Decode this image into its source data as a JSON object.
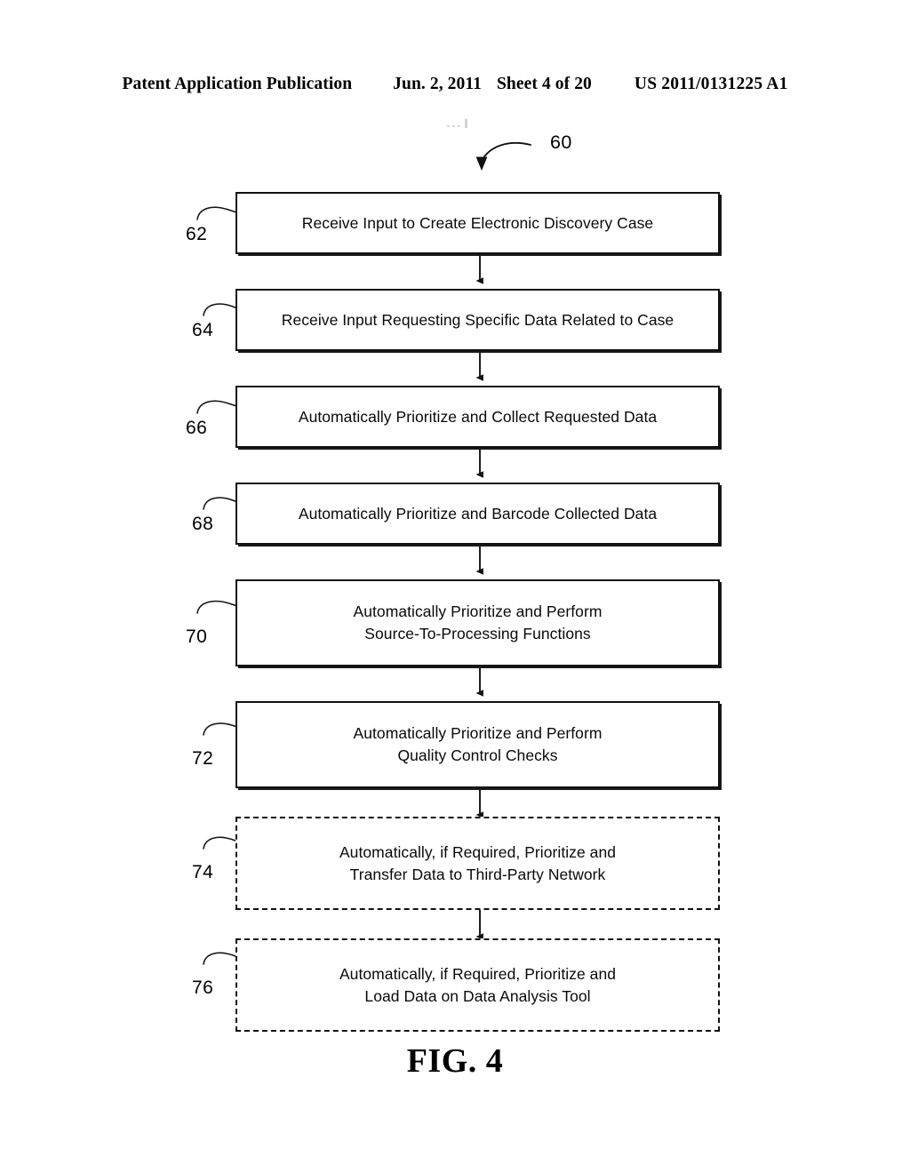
{
  "header": {
    "publication": "Patent Application Publication",
    "date": "Jun. 2, 2011",
    "sheet": "Sheet 4 of 20",
    "doc_number": "US 2011/0131225 A1"
  },
  "figure": {
    "caption": "FIG. 4",
    "diagram_ref": "60",
    "line_color": "#111111",
    "background": "#ffffff"
  },
  "flowchart": {
    "type": "flowchart",
    "orientation": "vertical",
    "steps": [
      {
        "ref": "62",
        "style": "solid",
        "lines": [
          "Receive Input to Create Electronic Discovery Case"
        ]
      },
      {
        "ref": "64",
        "style": "solid",
        "lines": [
          "Receive Input Requesting Specific Data Related to Case"
        ]
      },
      {
        "ref": "66",
        "style": "solid",
        "lines": [
          "Automatically Prioritize and Collect Requested Data"
        ]
      },
      {
        "ref": "68",
        "style": "solid",
        "lines": [
          "Automatically Prioritize and Barcode Collected Data"
        ]
      },
      {
        "ref": "70",
        "style": "solid",
        "lines": [
          "Automatically Prioritize and Perform",
          "Source-To-Processing Functions"
        ]
      },
      {
        "ref": "72",
        "style": "solid",
        "lines": [
          "Automatically Prioritize and Perform",
          "Quality Control Checks"
        ]
      },
      {
        "ref": "74",
        "style": "dashed",
        "lines": [
          "Automatically, if Required, Prioritize and",
          "Transfer Data to Third-Party Network"
        ]
      },
      {
        "ref": "76",
        "style": "dashed",
        "lines": [
          "Automatically, if Required, Prioritize and",
          "Load Data on Data Analysis Tool"
        ]
      }
    ]
  }
}
